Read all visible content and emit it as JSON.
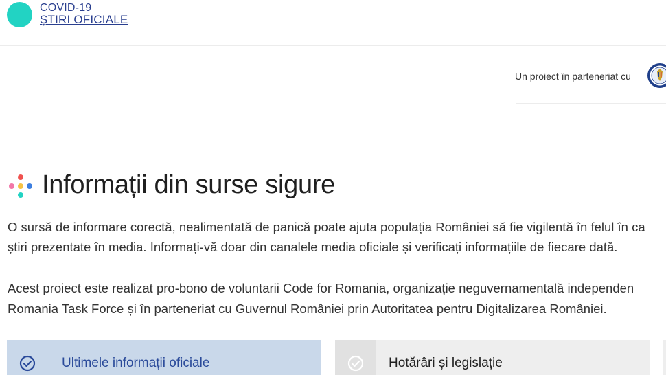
{
  "header": {
    "brand_line1": "COVID-19",
    "brand_line2": "ȘTIRI OFICIALE",
    "logo_color": "#22d3c3",
    "brand_color": "#2a3f8f"
  },
  "partner": {
    "text": "Un proiect în parteneriat cu",
    "seal_icon": "romanian-government-seal-icon"
  },
  "hero": {
    "title": "Informații din surse sigure",
    "paragraph1_line1": "O sursă de informare corectă, nealimentată de panică poate ajuta populația României să fie vigilentă în felul în ca",
    "paragraph1_line2": "știri prezentate în media. Informați-vă doar din canalele media oficiale și verificați informațiile de fiecare dată.",
    "paragraph2_line1": "Acest proiect este realizat pro-bono de voluntarii Code for Romania, organizație neguvernamentală independen",
    "paragraph2_line2": "Romania Task Force și în parteneriat cu Guvernul României prin Autoritatea pentru Digitalizarea României."
  },
  "cards": [
    {
      "label": "Ultimele informații oficiale",
      "icon": "check-circle-icon",
      "state": "active"
    },
    {
      "label": "Hotărâri și legislație",
      "icon": "check-circle-icon",
      "state": "inactive"
    }
  ],
  "colors": {
    "card_active_bg": "#c9d8ea",
    "card_inactive_bg": "#eeeeee",
    "dot_pink": "#f277a8",
    "dot_red": "#f0524f",
    "dot_yellow": "#f6c244",
    "dot_blue": "#3d7fe0",
    "dot_teal": "#22d3c3"
  }
}
